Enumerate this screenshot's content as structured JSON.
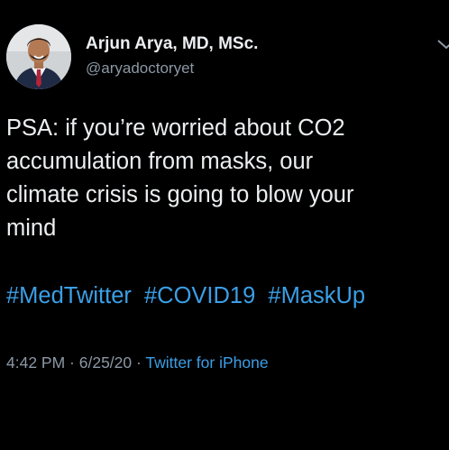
{
  "tweet": {
    "author": {
      "display_name": "Arjun Arya, MD, MSc.",
      "handle": "@aryadoctoryet",
      "avatar_icon": "profile-photo"
    },
    "text_lines": [
      "PSA: if you’re worried about CO2",
      "accumulation from masks, our",
      "climate crisis is going to blow your",
      "mind"
    ],
    "hashtags": [
      "#MedTwitter",
      "#COVID19",
      "#MaskUp"
    ],
    "meta": {
      "time": "4:42 PM",
      "separator": " · ",
      "date": "6/25/20",
      "separator2": " · ",
      "source": "Twitter for iPhone"
    },
    "menu_icon": "chevron-down-icon"
  },
  "colors": {
    "background": "#000000",
    "text": "#eceff1",
    "secondary": "#8b98a5",
    "link": "#3b9fe6"
  }
}
